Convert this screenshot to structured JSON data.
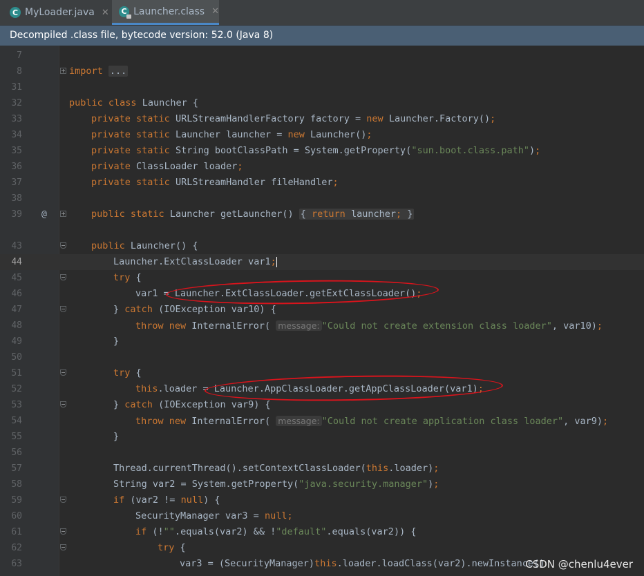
{
  "tabs": [
    {
      "label": "MyLoader.java",
      "icon": "class-file-icon",
      "close": "✕"
    },
    {
      "label": "Launcher.class",
      "icon": "locked-class-file-icon",
      "close": "✕",
      "active": true
    }
  ],
  "banner": "Decompiled .class file, bytecode version: 52.0 (Java 8)",
  "line_numbers": [
    "7",
    "8",
    "31",
    "32",
    "33",
    "34",
    "35",
    "36",
    "37",
    "38",
    "39",
    "43",
    "44",
    "45",
    "46",
    "47",
    "48",
    "49",
    "50",
    "51",
    "52",
    "53",
    "54",
    "55",
    "56",
    "57",
    "58",
    "59",
    "60",
    "61",
    "62",
    "63"
  ],
  "current_line": "44",
  "gutter_marker": "@",
  "code": {
    "l8": {
      "kw": "import",
      "fold": "..."
    },
    "l32": {
      "kw": "public class",
      "rest": "Launcher {"
    },
    "l33": {
      "kw1": "private static",
      "mid": "URLStreamHandlerFactory factory =",
      "kw2": "new",
      "rest": "Launcher.Factory()",
      "semi": ";"
    },
    "l34": {
      "kw1": "private static",
      "mid": "Launcher launcher =",
      "kw2": "new",
      "rest": "Launcher()",
      "semi": ";"
    },
    "l35": {
      "kw1": "private static",
      "mid": "String bootClassPath = System.getProperty(",
      "str": "\"sun.boot.class.path\"",
      "rest": ")",
      "semi": ";"
    },
    "l36": {
      "kw1": "private",
      "mid": "ClassLoader loader",
      "semi": ";"
    },
    "l37": {
      "kw1": "private static",
      "mid": "URLStreamHandler fileHandler",
      "semi": ";"
    },
    "l39": {
      "kw1": "public static",
      "mid": "Launcher getLauncher()",
      "open": "{",
      "kw2": "return",
      "rest": "launcher",
      "semi": ";",
      "close": "}"
    },
    "l43": {
      "kw1": "public",
      "rest": "Launcher() {"
    },
    "l44": {
      "rest": "Launcher.ExtClassLoader var1",
      "semi": ";"
    },
    "l45": {
      "kw1": "try",
      "rest": "{"
    },
    "l46": {
      "rest": "var1 = Launcher.ExtClassLoader.getExtClassLoader()",
      "semi": ";"
    },
    "l47": {
      "pre": "}",
      "kw1": "catch",
      "rest": "(IOException var10) {"
    },
    "l48": {
      "kw1": "throw new",
      "mid": "InternalError(",
      "hint": "message:",
      "str": "\"Could not create extension class loader\"",
      "rest": ", var10)",
      "semi": ";"
    },
    "l49": {
      "rest": "}"
    },
    "l51": {
      "kw1": "try",
      "rest": "{"
    },
    "l52": {
      "kw1": "this",
      "rest": ".loader = Launcher.AppClassLoader.getAppClassLoader(var1)",
      "semi": ";"
    },
    "l53": {
      "pre": "}",
      "kw1": "catch",
      "rest": "(IOException var9) {"
    },
    "l54": {
      "kw1": "throw new",
      "mid": "InternalError(",
      "hint": "message:",
      "str": "\"Could not create application class loader\"",
      "rest": ", var9)",
      "semi": ";"
    },
    "l55": {
      "rest": "}"
    },
    "l57": {
      "pre": "Thread.currentThread().setContextClassLoader(",
      "kw1": "this",
      "rest": ".loader)",
      "semi": ";"
    },
    "l58": {
      "pre": "String var2 = System.getProperty(",
      "str": "\"java.security.manager\"",
      "rest": ")",
      "semi": ";"
    },
    "l59": {
      "kw1": "if",
      "mid": "(var2 !=",
      "kw2": "null",
      "rest": ") {"
    },
    "l60": {
      "pre": "SecurityManager var3 =",
      "kw1": "null",
      "semi": ";"
    },
    "l61": {
      "kw1": "if",
      "mid": "(!",
      "str": "\"\"",
      "rest": ".equals(var2) && !",
      "str2": "\"default\"",
      "rest2": ".equals(var2)) {"
    },
    "l62": {
      "kw1": "try",
      "rest": "{"
    },
    "l63": {
      "pre": "var3 = (SecurityManager)",
      "kw1": "this",
      "rest": ".loader.loadClass(var2).newInstance()"
    }
  },
  "watermark": "CSDN @chenlu4ever",
  "colors": {
    "keyword": "#cc7832",
    "string": "#6a8759",
    "text": "#a9b7c6",
    "annotation": "#d9141c"
  }
}
